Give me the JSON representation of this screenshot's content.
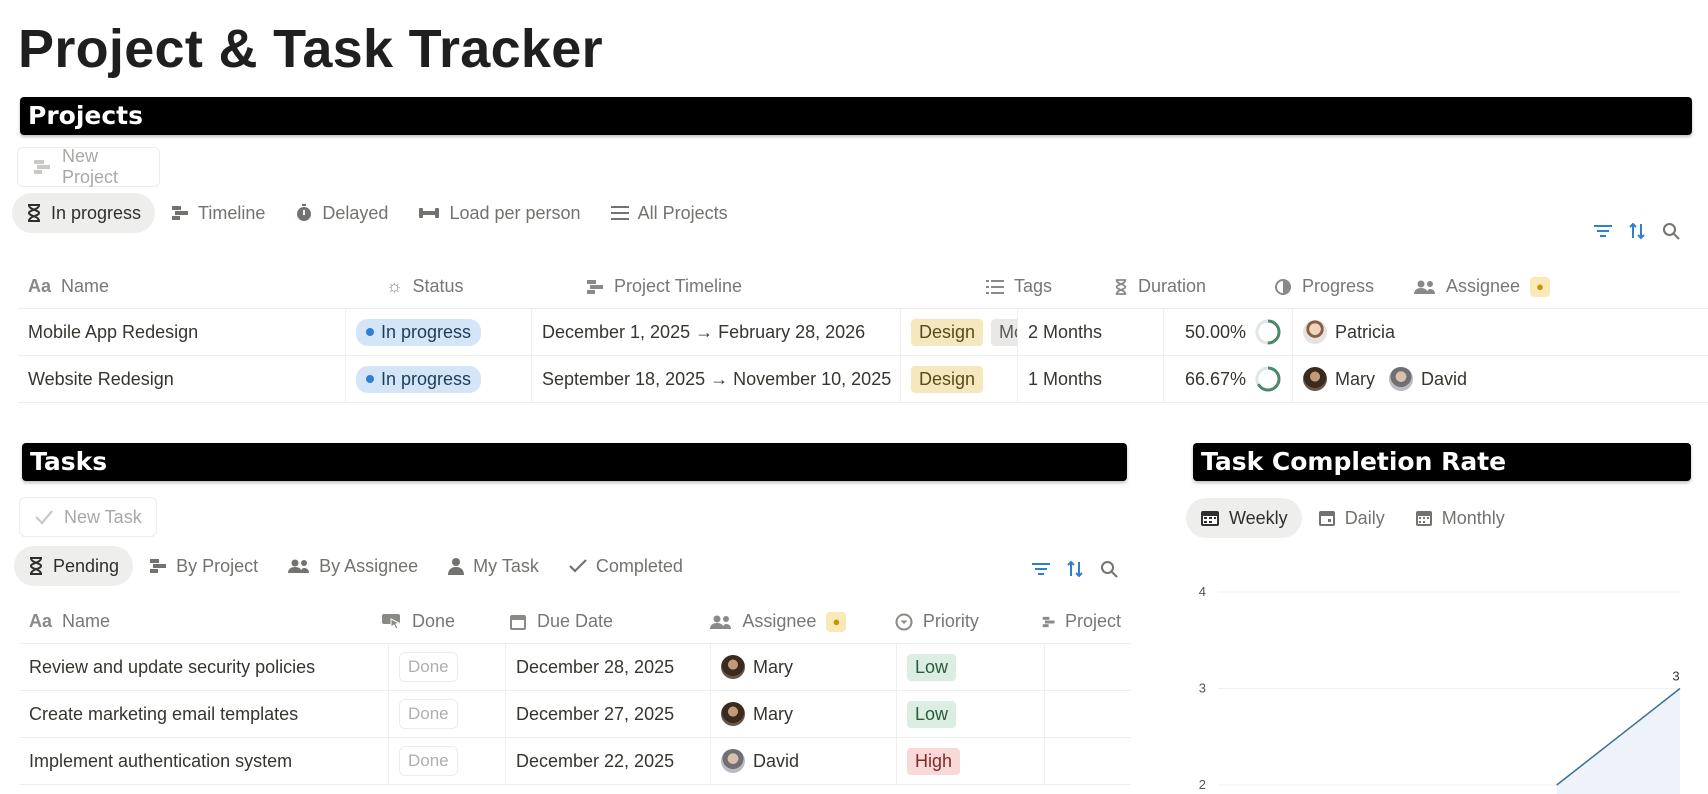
{
  "page": {
    "title": "Project & Task Tracker"
  },
  "projects": {
    "section_title": "Projects",
    "new_button": "New Project",
    "tabs": [
      {
        "label": "In progress",
        "icon": "hourglass-icon",
        "active": true
      },
      {
        "label": "Timeline",
        "icon": "timeline-icon",
        "active": false
      },
      {
        "label": "Delayed",
        "icon": "delayed-icon",
        "active": false
      },
      {
        "label": "Load per person",
        "icon": "dumbbell-icon",
        "active": false
      },
      {
        "label": "All Projects",
        "icon": "list-icon",
        "active": false
      }
    ],
    "columns": [
      "Name",
      "Status",
      "Project Timeline",
      "Tags",
      "Duration",
      "Progress",
      "Assignee"
    ],
    "rows": [
      {
        "name": "Mobile App Redesign",
        "status": "In progress",
        "timeline": "December 1, 2025 → February 28, 2026",
        "tags": [
          "Design",
          "Mobile"
        ],
        "duration": "2 Months",
        "progress": "50.00%",
        "progress_value": 0.5,
        "assignees": [
          "Patricia"
        ]
      },
      {
        "name": "Website Redesign",
        "status": "In progress",
        "timeline": "September 18, 2025 → November 10, 2025",
        "tags": [
          "Design"
        ],
        "duration": "1 Months",
        "progress": "66.67%",
        "progress_value": 0.6667,
        "assignees": [
          "Mary",
          "David"
        ]
      }
    ]
  },
  "tasks": {
    "section_title": "Tasks",
    "new_button": "New Task",
    "tabs": [
      {
        "label": "Pending",
        "icon": "hourglass-icon",
        "active": true
      },
      {
        "label": "By Project",
        "icon": "timeline-icon",
        "active": false
      },
      {
        "label": "By Assignee",
        "icon": "people-icon",
        "active": false
      },
      {
        "label": "My Task",
        "icon": "person-icon",
        "active": false
      },
      {
        "label": "Completed",
        "icon": "check-icon",
        "active": false
      }
    ],
    "columns": [
      "Name",
      "Done",
      "Due Date",
      "Assignee",
      "Priority",
      "Project"
    ],
    "rows": [
      {
        "name": "Review and update security policies",
        "done": "Done",
        "due": "December 28, 2025",
        "assignee": "Mary",
        "priority": "Low"
      },
      {
        "name": "Create marketing email templates",
        "done": "Done",
        "due": "December 27, 2025",
        "assignee": "Mary",
        "priority": "Low"
      },
      {
        "name": "Implement authentication system",
        "done": "Done",
        "due": "December 22, 2025",
        "assignee": "David",
        "priority": "High"
      }
    ]
  },
  "completion": {
    "section_title": "Task Completion Rate",
    "tabs": [
      {
        "label": "Weekly",
        "icon": "calendar-icon",
        "active": true
      },
      {
        "label": "Daily",
        "icon": "calendar-day-icon",
        "active": false
      },
      {
        "label": "Monthly",
        "icon": "calendar-grid-icon",
        "active": false
      }
    ]
  },
  "chart_data": {
    "type": "area",
    "title": "",
    "xlabel": "",
    "ylabel": "",
    "y_ticks": [
      2,
      3,
      4
    ],
    "ylim": [
      2,
      4
    ],
    "grid": true,
    "series": [
      {
        "x": [
          0.74,
          1.0
        ],
        "values": [
          2,
          3
        ],
        "point_labels": [
          "",
          "3"
        ]
      }
    ]
  },
  "colors": {
    "accent": "#2f7fd1",
    "progress_ring": "#4a8a6a",
    "chart_line": "#3a6f93",
    "chart_fill": "#eef3fa"
  }
}
